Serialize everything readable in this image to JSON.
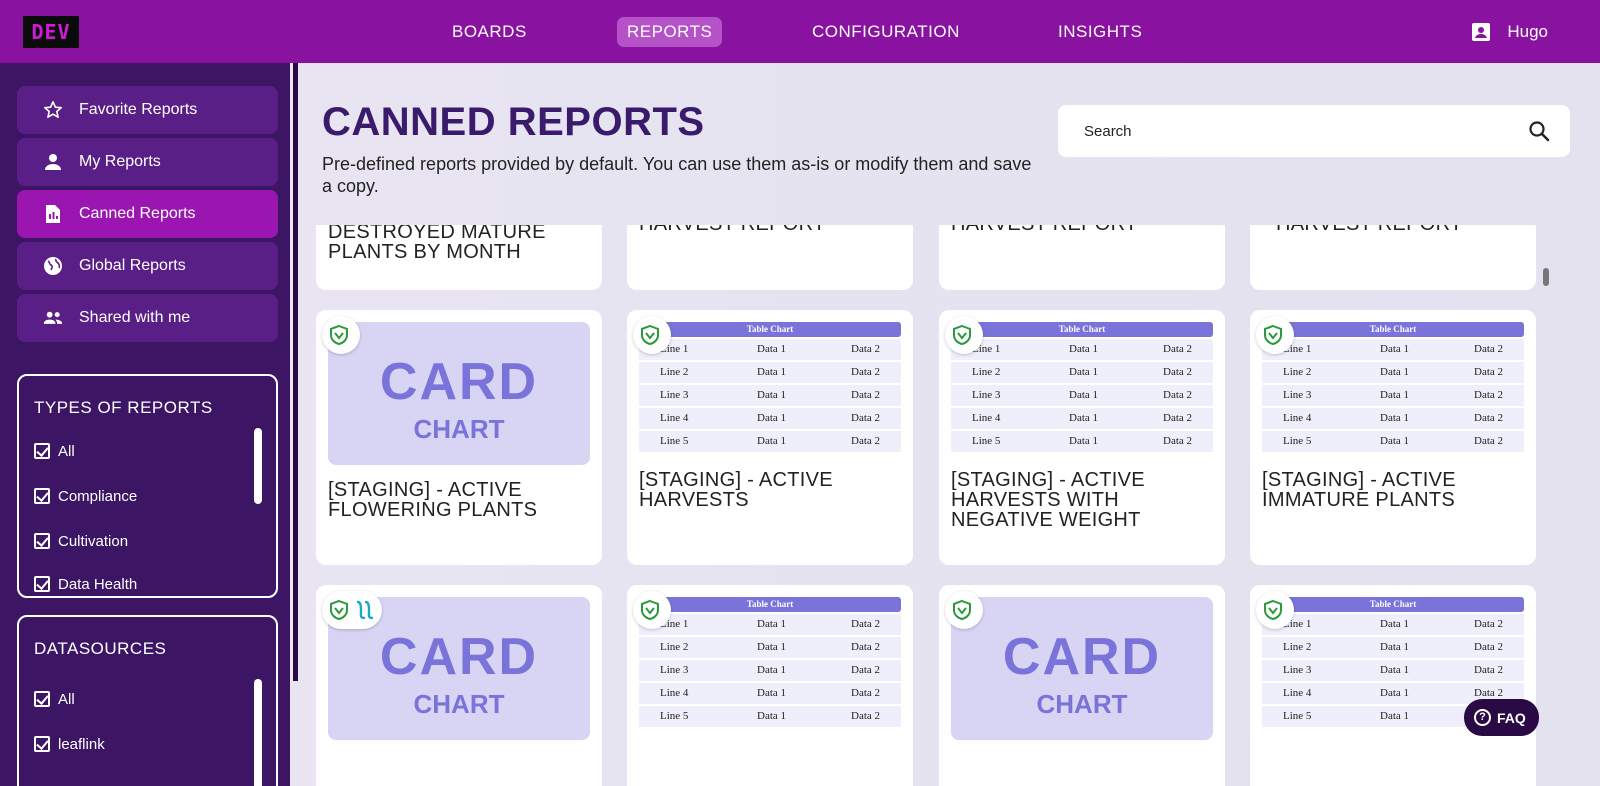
{
  "app": {
    "env_label": "DEV",
    "user_name": "Hugo"
  },
  "nav": {
    "boards": "BOARDS",
    "reports": "REPORTS",
    "configuration": "CONFIGURATION",
    "insights": "INSIGHTS"
  },
  "sidebar": {
    "items": [
      {
        "label": "Favorite Reports",
        "icon": "star-icon"
      },
      {
        "label": "My Reports",
        "icon": "person-icon"
      },
      {
        "label": "Canned Reports",
        "icon": "document-icon",
        "active": true
      },
      {
        "label": "Global Reports",
        "icon": "globe-icon"
      },
      {
        "label": "Shared with me",
        "icon": "people-icon"
      }
    ],
    "types_title": "TYPES OF REPORTS",
    "types": [
      "All",
      "Compliance",
      "Cultivation",
      "Data Health"
    ],
    "datasources_title": "DATASOURCES",
    "datasources": [
      "All",
      "leaflink"
    ]
  },
  "main": {
    "title": "CANNED REPORTS",
    "subtitle": "Pre-defined reports provided by default. You can use them as-is or modify them and save a copy.",
    "search_placeholder": "Search"
  },
  "cards_top": [
    {
      "title_line1": "DESTROYED MATURE",
      "title_line2": "PLANTS BY MONTH"
    },
    {
      "title_line1": "HARVEST REPORT"
    },
    {
      "title_line1": "HARVEST REPORT"
    },
    {
      "title_line1": "HARVEST REPORT"
    }
  ],
  "cards_mid": [
    {
      "type": "card",
      "title_line1": "[STAGING] - ACTIVE",
      "title_line2": "FLOWERING PLANTS"
    },
    {
      "type": "table",
      "title_line1": "[STAGING] - ACTIVE",
      "title_line2": "HARVESTS"
    },
    {
      "type": "table",
      "title_line1": "[STAGING] - ACTIVE",
      "title_line2": "HARVESTS WITH",
      "title_line3": "NEGATIVE WEIGHT"
    },
    {
      "type": "table",
      "title_line1": "[STAGING] - ACTIVE",
      "title_line2": "IMMATURE PLANTS"
    }
  ],
  "card_chart": {
    "line1": "CARD",
    "line2": "CHART"
  },
  "table_chart": {
    "header": "Table Chart",
    "rows": [
      [
        "Line 1",
        "Data 1",
        "Data 2"
      ],
      [
        "Line 2",
        "Data 1",
        "Data 2"
      ],
      [
        "Line 3",
        "Data 1",
        "Data 2"
      ],
      [
        "Line 4",
        "Data 1",
        "Data 2"
      ],
      [
        "Line 5",
        "Data 1",
        "Data 2"
      ]
    ]
  },
  "faq_label": "FAQ",
  "colors": {
    "topbar": "#8a12a0",
    "sidebar": "#3c1664",
    "accent": "#9b16b0",
    "chart": "#7a73d9"
  }
}
